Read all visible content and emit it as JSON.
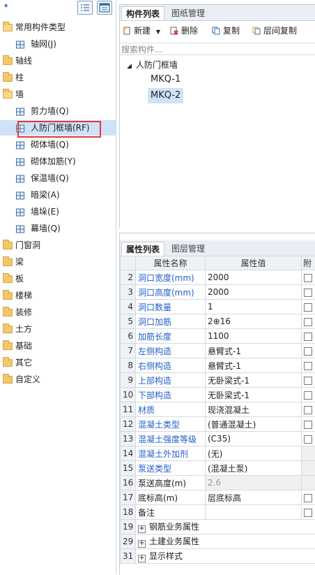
{
  "left_tree": {
    "items": [
      {
        "label": "常用构件类型",
        "level": 0,
        "icon": "folder-open-icon"
      },
      {
        "label": "轴网(J)",
        "level": 1,
        "icon": "grid-icon"
      },
      {
        "label": "轴线",
        "level": 0,
        "icon": "folder-icon"
      },
      {
        "label": "柱",
        "level": 0,
        "icon": "folder-icon"
      },
      {
        "label": "墙",
        "level": 0,
        "icon": "folder-open-icon"
      },
      {
        "label": "剪力墙(Q)",
        "level": 1,
        "icon": "shear-wall-icon"
      },
      {
        "label": "人防门框墙(RF)",
        "level": 1,
        "icon": "door-frame-wall-icon",
        "selected": true
      },
      {
        "label": "砌体墙(Q)",
        "level": 1,
        "icon": "masonry-wall-icon"
      },
      {
        "label": "砌体加筋(Y)",
        "level": 1,
        "icon": "masonry-rebar-icon"
      },
      {
        "label": "保温墙(Q)",
        "level": 1,
        "icon": "insulation-wall-icon"
      },
      {
        "label": "暗梁(A)",
        "level": 1,
        "icon": "hidden-beam-icon"
      },
      {
        "label": "墙垛(E)",
        "level": 1,
        "icon": "wall-pier-icon"
      },
      {
        "label": "幕墙(Q)",
        "level": 1,
        "icon": "curtain-wall-icon"
      },
      {
        "label": "门窗洞",
        "level": 0,
        "icon": "folder-icon"
      },
      {
        "label": "梁",
        "level": 0,
        "icon": "folder-icon"
      },
      {
        "label": "板",
        "level": 0,
        "icon": "folder-icon"
      },
      {
        "label": "楼梯",
        "level": 0,
        "icon": "folder-icon"
      },
      {
        "label": "装修",
        "level": 0,
        "icon": "folder-icon"
      },
      {
        "label": "土方",
        "level": 0,
        "icon": "folder-icon"
      },
      {
        "label": "基础",
        "level": 0,
        "icon": "folder-icon"
      },
      {
        "label": "其它",
        "level": 0,
        "icon": "folder-icon"
      },
      {
        "label": "自定义",
        "level": 0,
        "icon": "folder-icon"
      }
    ]
  },
  "component_panel": {
    "tabs": [
      "构件列表",
      "图纸管理"
    ],
    "toolbar": {
      "new": "新建",
      "delete": "删除",
      "copy": "复制",
      "floor_copy": "层间复制"
    },
    "search_placeholder": "搜索构件...",
    "root": "人防门框墙",
    "items": [
      "MKQ-1",
      "MKQ-2"
    ],
    "selected": "MKQ-2"
  },
  "property_panel": {
    "tabs": [
      "属性列表",
      "图层管理"
    ],
    "headers": {
      "name": "属性名称",
      "value": "属性值",
      "extra": "附"
    },
    "rows": [
      {
        "n": "2",
        "name": "洞口宽度(mm)",
        "value": "2000",
        "blue": true,
        "cb": true
      },
      {
        "n": "3",
        "name": "洞口高度(mm)",
        "value": "2000",
        "blue": true,
        "cb": true
      },
      {
        "n": "4",
        "name": "洞口数量",
        "value": "1",
        "blue": true,
        "cb": true
      },
      {
        "n": "5",
        "name": "洞口加筋",
        "value": "2⊕16",
        "blue": true,
        "cb": true
      },
      {
        "n": "6",
        "name": "加筋长度",
        "value": "1100",
        "blue": true,
        "cb": true
      },
      {
        "n": "7",
        "name": "左侧构造",
        "value": "悬臂式-1",
        "blue": true,
        "cb": true
      },
      {
        "n": "8",
        "name": "右侧构造",
        "value": "悬臂式-1",
        "blue": true,
        "cb": true
      },
      {
        "n": "9",
        "name": "上部构造",
        "value": "无卧梁式-1",
        "blue": true,
        "cb": true
      },
      {
        "n": "10",
        "name": "下部构造",
        "value": "无卧梁式-1",
        "blue": true,
        "cb": true
      },
      {
        "n": "11",
        "name": "材质",
        "value": "现浇混凝土",
        "blue": true,
        "cb": true
      },
      {
        "n": "12",
        "name": "混凝土类型",
        "value": "(普通混凝土)",
        "blue": true,
        "cb": true
      },
      {
        "n": "13",
        "name": "混凝土强度等级",
        "value": "(C35)",
        "blue": true,
        "cb": true
      },
      {
        "n": "14",
        "name": "混凝土外加剂",
        "value": "(无)",
        "blue": true,
        "cb": false
      },
      {
        "n": "15",
        "name": "泵送类型",
        "value": "(混凝土泵)",
        "blue": true,
        "cb": false
      },
      {
        "n": "16",
        "name": "泵送高度(m)",
        "value": "2.6",
        "blue": false,
        "cb": false,
        "disabled": true
      },
      {
        "n": "17",
        "name": "底标高(m)",
        "value": "层底标高",
        "blue": false,
        "cb": true
      },
      {
        "n": "18",
        "name": "备注",
        "value": "",
        "blue": false,
        "cb": true
      },
      {
        "n": "19",
        "name": "钢筋业务属性",
        "value": "",
        "group": true
      },
      {
        "n": "29",
        "name": "土建业务属性",
        "value": "",
        "group": true
      },
      {
        "n": "31",
        "name": "显示样式",
        "value": "",
        "group": true
      }
    ]
  },
  "colors": {
    "accent_blue": "#1f5fc9",
    "selection": "#cfe2f7",
    "highlight_box": "#e53935",
    "folder": "#f3c76a"
  }
}
